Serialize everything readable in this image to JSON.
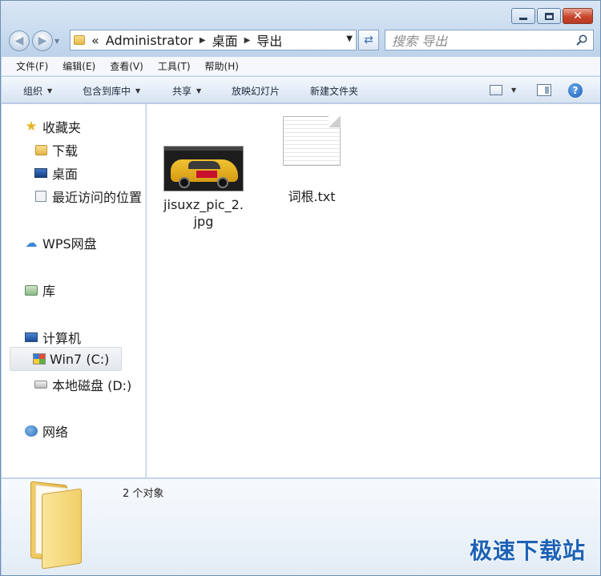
{
  "address": {
    "crumb_overflow": "«",
    "crumbs": [
      "Administrator",
      "桌面",
      "导出"
    ]
  },
  "search": {
    "placeholder": "搜索 导出"
  },
  "menu": [
    "文件(F)",
    "编辑(E)",
    "查看(V)",
    "工具(T)",
    "帮助(H)"
  ],
  "toolbar": {
    "organize": "组织",
    "include_library": "包含到库中",
    "share": "共享",
    "slideshow": "放映幻灯片",
    "new_folder": "新建文件夹"
  },
  "sidebar": {
    "favorites": "收藏夹",
    "downloads": "下载",
    "desktop": "桌面",
    "recent": "最近访问的位置",
    "wps": "WPS网盘",
    "libraries": "库",
    "computer": "计算机",
    "drive_c": "Win7 (C:)",
    "drive_d": "本地磁盘 (D:)",
    "network": "网络"
  },
  "files": [
    {
      "name_line1": "jisuxz_pic_2.",
      "name_line2": "jpg",
      "type": "image"
    },
    {
      "name_line1": "词根.txt",
      "type": "text"
    }
  ],
  "details": {
    "count": "2 个对象"
  },
  "watermark": "极速下载站"
}
